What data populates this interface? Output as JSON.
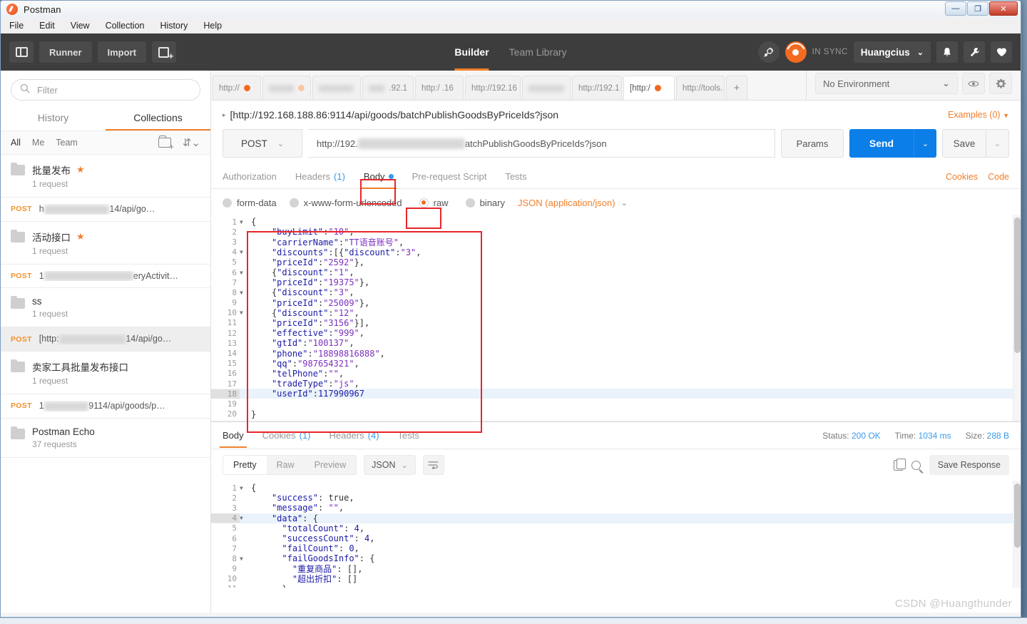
{
  "window": {
    "title": "Postman",
    "controls": {
      "minimize": "—",
      "maximize": "❐",
      "close": "✕"
    }
  },
  "menubar": {
    "items": [
      "File",
      "Edit",
      "View",
      "Collection",
      "History",
      "Help"
    ]
  },
  "toolbar": {
    "sidebar_toggle": "",
    "runner_label": "Runner",
    "import_label": "Import",
    "new_tab_label": "",
    "center_tabs": [
      {
        "label": "Builder",
        "active": true
      },
      {
        "label": "Team Library",
        "active": false
      }
    ],
    "sync_status": "IN SYNC",
    "user_name": "Huangcius",
    "user_caret": "⌄"
  },
  "sidebar": {
    "filter_placeholder": "Filter",
    "tabs": [
      {
        "label": "History",
        "active": false
      },
      {
        "label": "Collections",
        "active": true
      }
    ],
    "scope_filters": [
      {
        "label": "All",
        "active": true
      },
      {
        "label": "Me",
        "active": false
      },
      {
        "label": "Team",
        "active": false
      }
    ],
    "entries": [
      {
        "type": "collection",
        "name": "批量发布",
        "starred": true,
        "sub": "1 request"
      },
      {
        "type": "request",
        "verb": "POST",
        "url_prefix": "h",
        "url_suffix": "14/api/go…",
        "selected": false
      },
      {
        "type": "collection",
        "name": "活动接口",
        "starred": true,
        "sub": "1 request"
      },
      {
        "type": "request",
        "verb": "POST",
        "url_prefix": "1",
        "url_suffix": "eryActivit…",
        "selected": false
      },
      {
        "type": "collection",
        "name": "ss",
        "starred": false,
        "sub": "1 request"
      },
      {
        "type": "request",
        "verb": "POST",
        "url_prefix": "[http:",
        "url_suffix": "14/api/go…",
        "selected": true
      },
      {
        "type": "collection",
        "name": "卖家工具批量发布接口",
        "starred": false,
        "sub": "1 request"
      },
      {
        "type": "request",
        "verb": "POST",
        "url_prefix": "1",
        "url_suffix": "9114/api/goods/p…",
        "selected": false
      },
      {
        "type": "collection",
        "name": "Postman Echo",
        "starred": false,
        "sub": "37 requests"
      }
    ]
  },
  "request_tabs": [
    {
      "label": "http://",
      "unsaved": true,
      "active": false,
      "blurred": false
    },
    {
      "label": "",
      "unsaved": true,
      "unsaved_pale": true,
      "active": false,
      "blurred": true
    },
    {
      "label": "",
      "unsaved": false,
      "active": false,
      "blurred": true
    },
    {
      "label": ".92.1",
      "unsaved": false,
      "active": false,
      "blurred": true
    },
    {
      "label": "http:/   .16",
      "unsaved": false,
      "active": false,
      "blurred": true
    },
    {
      "label": "http://192.16",
      "unsaved": false,
      "active": false,
      "blurred": false
    },
    {
      "label": "",
      "unsaved": false,
      "active": false,
      "blurred": true
    },
    {
      "label": "http://192.1",
      "unsaved": false,
      "active": false,
      "blurred": false
    },
    {
      "label": "[http:/",
      "unsaved": true,
      "active": true,
      "blurred": false
    },
    {
      "label": "http://tools.",
      "unsaved": false,
      "active": false,
      "blurred": false
    }
  ],
  "request_tab_add": "+",
  "environment": {
    "selected": "No Environment",
    "caret": "⌄",
    "eye_icon": "eye-icon",
    "gear_icon": "gear-icon"
  },
  "breadcrumb": {
    "caret": "▸",
    "name": "[http://192.168.188.86:9114/api/goods/batchPublishGoodsByPriceIds?json",
    "examples": "Examples (0)",
    "examples_caret": "▼"
  },
  "url_bar": {
    "method": "POST",
    "method_caret": "⌄",
    "url_prefix": "http://192.",
    "url_suffix": "atchPublishGoodsByPriceIds?json",
    "params_label": "Params",
    "send_label": "Send",
    "send_caret": "⌄",
    "save_label": "Save",
    "save_caret": "⌄"
  },
  "request_tabs_row": {
    "tabs": [
      {
        "label": "Authorization",
        "active": false,
        "count": null,
        "dot": false
      },
      {
        "label": "Headers",
        "active": false,
        "count": "(1)",
        "dot": false
      },
      {
        "label": "Body",
        "active": true,
        "count": null,
        "dot": true
      },
      {
        "label": "Pre-request Script",
        "active": false,
        "count": null,
        "dot": false
      },
      {
        "label": "Tests",
        "active": false,
        "count": null,
        "dot": false
      }
    ],
    "cookies_link": "Cookies",
    "code_link": "Code"
  },
  "body_types": {
    "options": [
      {
        "label": "form-data",
        "selected": false
      },
      {
        "label": "x-www-form-urlencoded",
        "selected": false
      },
      {
        "label": "raw",
        "selected": true
      },
      {
        "label": "binary",
        "selected": false
      }
    ],
    "content_type": "JSON (application/json)",
    "content_type_caret": "⌄"
  },
  "request_body": {
    "lines": [
      {
        "n": 1,
        "fold": true,
        "text": "{"
      },
      {
        "n": 2,
        "fold": false,
        "text": "    \"buyLimit\":\"10\","
      },
      {
        "n": 3,
        "fold": false,
        "text": "    \"carrierName\":\"TT语音账号\","
      },
      {
        "n": 4,
        "fold": true,
        "text": "    \"discounts\":[{\"discount\":\"3\","
      },
      {
        "n": 5,
        "fold": false,
        "text": "    \"priceId\":\"2592\"},"
      },
      {
        "n": 6,
        "fold": true,
        "text": "    {\"discount\":\"1\","
      },
      {
        "n": 7,
        "fold": false,
        "text": "    \"priceId\":\"19375\"},"
      },
      {
        "n": 8,
        "fold": true,
        "text": "    {\"discount\":\"3\","
      },
      {
        "n": 9,
        "fold": false,
        "text": "    \"priceId\":\"25009\"},"
      },
      {
        "n": 10,
        "fold": true,
        "text": "    {\"discount\":\"12\","
      },
      {
        "n": 11,
        "fold": false,
        "text": "    \"priceId\":\"3156\"}],"
      },
      {
        "n": 12,
        "fold": false,
        "text": "    \"effective\":\"999\","
      },
      {
        "n": 13,
        "fold": false,
        "text": "    \"gtId\":\"100137\","
      },
      {
        "n": 14,
        "fold": false,
        "text": "    \"phone\":\"18898816888\","
      },
      {
        "n": 15,
        "fold": false,
        "text": "    \"qq\":\"987654321\","
      },
      {
        "n": 16,
        "fold": false,
        "text": "    \"telPhone\":\"\","
      },
      {
        "n": 17,
        "fold": false,
        "text": "    \"tradeType\":\"js\","
      },
      {
        "n": 18,
        "fold": false,
        "text": "    \"userId\":117990967",
        "highlight": true
      },
      {
        "n": 19,
        "fold": false,
        "text": ""
      },
      {
        "n": 20,
        "fold": false,
        "text": "}"
      }
    ]
  },
  "response": {
    "tabs": [
      {
        "label": "Body",
        "active": true,
        "count": null
      },
      {
        "label": "Cookies",
        "active": false,
        "count": "(1)"
      },
      {
        "label": "Headers",
        "active": false,
        "count": "(4)"
      },
      {
        "label": "Tests",
        "active": false,
        "count": null
      }
    ],
    "stats": [
      {
        "label": "Status:",
        "value": "200 OK"
      },
      {
        "label": "Time:",
        "value": "1034 ms"
      },
      {
        "label": "Size:",
        "value": "288 B"
      }
    ],
    "view_modes": [
      {
        "label": "Pretty",
        "active": true
      },
      {
        "label": "Raw",
        "active": false
      },
      {
        "label": "Preview",
        "active": false
      }
    ],
    "format": "JSON",
    "format_caret": "⌄",
    "wrap_icon": "wrap-lines-icon",
    "copy_icon": "copy-icon",
    "search_icon": "search-icon",
    "save_response_label": "Save Response",
    "body_lines": [
      {
        "n": 1,
        "fold": true,
        "text": "{"
      },
      {
        "n": 2,
        "fold": false,
        "text": "    \"success\": true,"
      },
      {
        "n": 3,
        "fold": false,
        "text": "    \"message\": \"\","
      },
      {
        "n": 4,
        "fold": true,
        "text": "    \"data\": {",
        "highlight": true
      },
      {
        "n": 5,
        "fold": false,
        "text": "      \"totalCount\": 4,"
      },
      {
        "n": 6,
        "fold": false,
        "text": "      \"successCount\": 4,"
      },
      {
        "n": 7,
        "fold": false,
        "text": "      \"failCount\": 0,"
      },
      {
        "n": 8,
        "fold": true,
        "text": "      \"failGoodsInfo\": {"
      },
      {
        "n": 9,
        "fold": false,
        "text": "        \"重复商品\": [],"
      },
      {
        "n": 10,
        "fold": false,
        "text": "        \"超出折扣\": []"
      },
      {
        "n": 11,
        "fold": false,
        "text": "      }"
      }
    ]
  },
  "watermark": "CSDN @Huangthunder",
  "colors": {
    "accent_orange": "#f07f2d",
    "send_blue": "#0b7ee8",
    "annotation_red": "#e8262a",
    "link_blue": "#3a9ae8",
    "toolbar_dark": "#3d3d3d"
  }
}
